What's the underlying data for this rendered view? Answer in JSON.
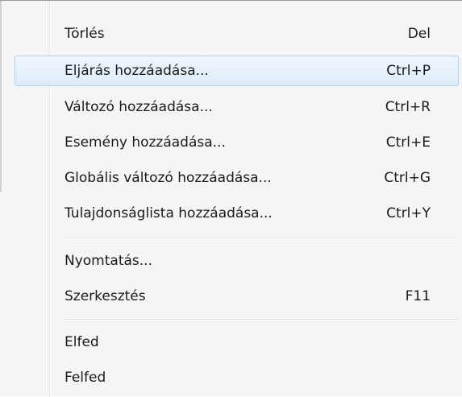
{
  "menu": {
    "items": [
      {
        "label": "Törlés",
        "shortcut": "Del"
      },
      {
        "label": "Eljárás hozzáadása...",
        "shortcut": "Ctrl+P",
        "highlighted": true
      },
      {
        "label": "Változó hozzáadása...",
        "shortcut": "Ctrl+R"
      },
      {
        "label": "Esemény hozzáadása...",
        "shortcut": "Ctrl+E"
      },
      {
        "label": "Globális változó hozzáadása...",
        "shortcut": "Ctrl+G"
      },
      {
        "label": "Tulajdonságlista hozzáadása...",
        "shortcut": "Ctrl+Y"
      },
      {
        "label": "Nyomtatás...",
        "shortcut": ""
      },
      {
        "label": "Szerkesztés",
        "shortcut": "F11"
      },
      {
        "label": "Elfed",
        "shortcut": ""
      },
      {
        "label": "Felfed",
        "shortcut": ""
      }
    ],
    "colors": {
      "background": "#f5f5f5",
      "highlight_border": "#aed0ee",
      "highlight_fill": "#dcebf8"
    }
  }
}
